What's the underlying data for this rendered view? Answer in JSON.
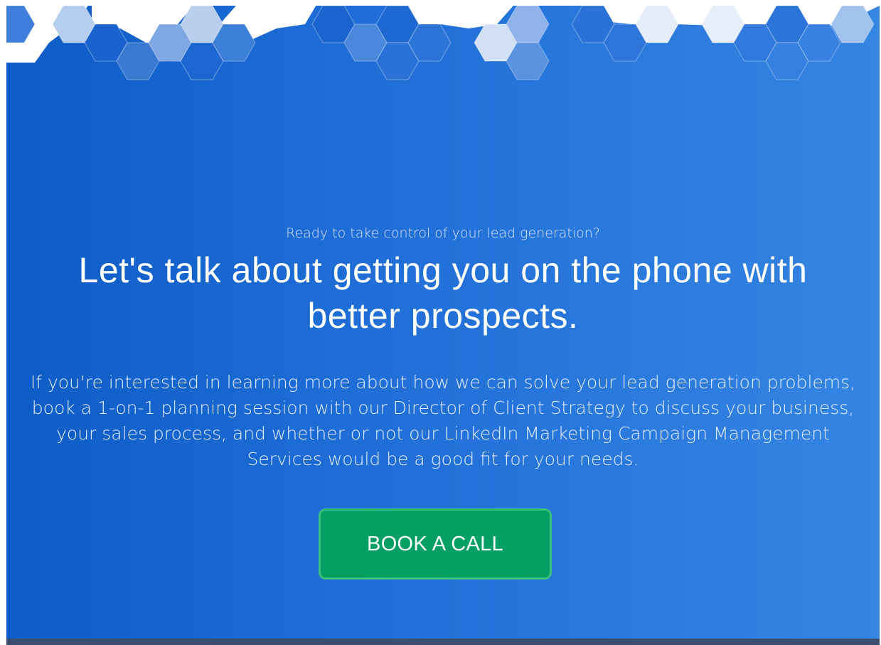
{
  "hero": {
    "eyebrow": "Ready to take control of your lead generation?",
    "headline": "Let's talk about getting you on the phone with better prospects.",
    "body": "If you're interested in learning more about how we can solve your lead generation problems, book a 1-on-1 planning session with our Director of Client Strategy to discuss your business, your sales process, and whether or not our LinkedIn Marketing Campaign Management Services would be a good fit for your needs.",
    "cta_label": "BOOK A CALL"
  },
  "colors": {
    "hero_gradient_start": "#0d5cc5",
    "hero_gradient_end": "#3585e3",
    "cta_background": "#049f62",
    "cta_border": "#38c07f",
    "footer": "#3b4e6f"
  },
  "decoration": {
    "pattern_icon": "hexagon-pattern-icon"
  }
}
